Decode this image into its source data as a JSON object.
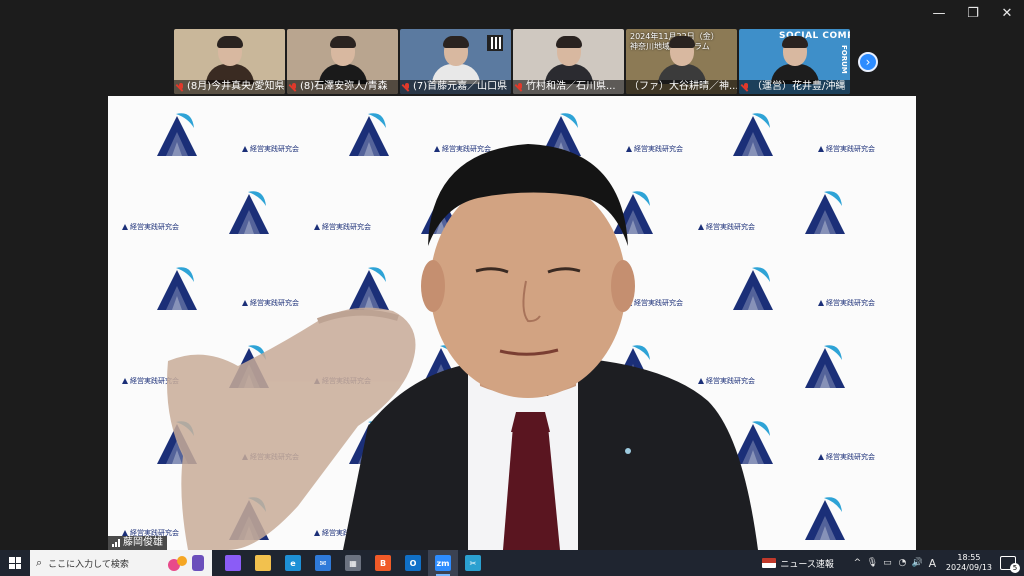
{
  "window_controls": {
    "minimize": "—",
    "restore": "❐",
    "close": "✕"
  },
  "gallery": {
    "tiles": [
      {
        "name": "(8月)今井真央/愛知県",
        "bg": "#c9b79a",
        "shirt": "#3a2b22",
        "muted": true
      },
      {
        "name": "(8)石澤安弥人/青森",
        "bg": "#b9a58f",
        "shirt": "#1a1a1a",
        "muted": true
      },
      {
        "name": "(7)首藤元嘉／山口県",
        "bg": "#5b7aa0",
        "shirt": "#e8e8e8",
        "muted": true
      },
      {
        "name": "竹村和浩／石川県...",
        "bg": "#cfc8c0",
        "shirt": "#2b2b30",
        "muted": true
      },
      {
        "name": "（ファ）大谷耕晴／神...",
        "bg": "#8c7a55",
        "shirt": "#3b3b3b",
        "muted": false,
        "overlay_line1": "2024年11月22日（金）",
        "overlay_line2": "神奈川地域フォーラム"
      },
      {
        "name": "（運営）花井豊/沖縄",
        "bg": "#3e8fc9",
        "shirt": "#1d1d1d",
        "muted": true,
        "overlay_title": "SOCIAL COMPANY",
        "overlay_side": "FORUM"
      }
    ],
    "next_icon": "›"
  },
  "main_video": {
    "speaker_name": "藤岡俊雄",
    "backdrop_wordmark": "経営実践研究会",
    "brand_color": "#1b2f78",
    "accent_color": "#2ea3d6"
  },
  "taskbar": {
    "search_placeholder": "ここに入力して検索",
    "apps": [
      {
        "icon": "copilot-icon",
        "glyph": "",
        "color": "#8b5cf6",
        "active": false
      },
      {
        "icon": "file-explorer-icon",
        "glyph": "",
        "color": "#f2c14e",
        "active": false
      },
      {
        "icon": "edge-icon",
        "glyph": "e",
        "color": "#1e90d6",
        "active": false
      },
      {
        "icon": "mail-icon",
        "glyph": "✉",
        "color": "#2f7ad9",
        "active": false
      },
      {
        "icon": "calculator-icon",
        "glyph": "▦",
        "color": "#6b7280",
        "active": false
      },
      {
        "icon": "brave-icon",
        "glyph": "B",
        "color": "#f05a28",
        "active": false
      },
      {
        "icon": "outlook-icon",
        "glyph": "O",
        "color": "#1070c8",
        "active": false
      },
      {
        "icon": "zoom-icon",
        "glyph": "zm",
        "color": "#2d8cff",
        "active": true
      },
      {
        "icon": "snipping-tool-icon",
        "glyph": "✂",
        "color": "#2ba0d0",
        "active": false
      }
    ],
    "news_label": "ニュース速報",
    "tray_icons": {
      "chevron": "^",
      "mic": "🎙",
      "network": "▭",
      "wifi": "◔",
      "volume": "🔊",
      "ime": "A"
    },
    "time": "18:55",
    "date": "2024/09/13",
    "notification_count": "5"
  }
}
